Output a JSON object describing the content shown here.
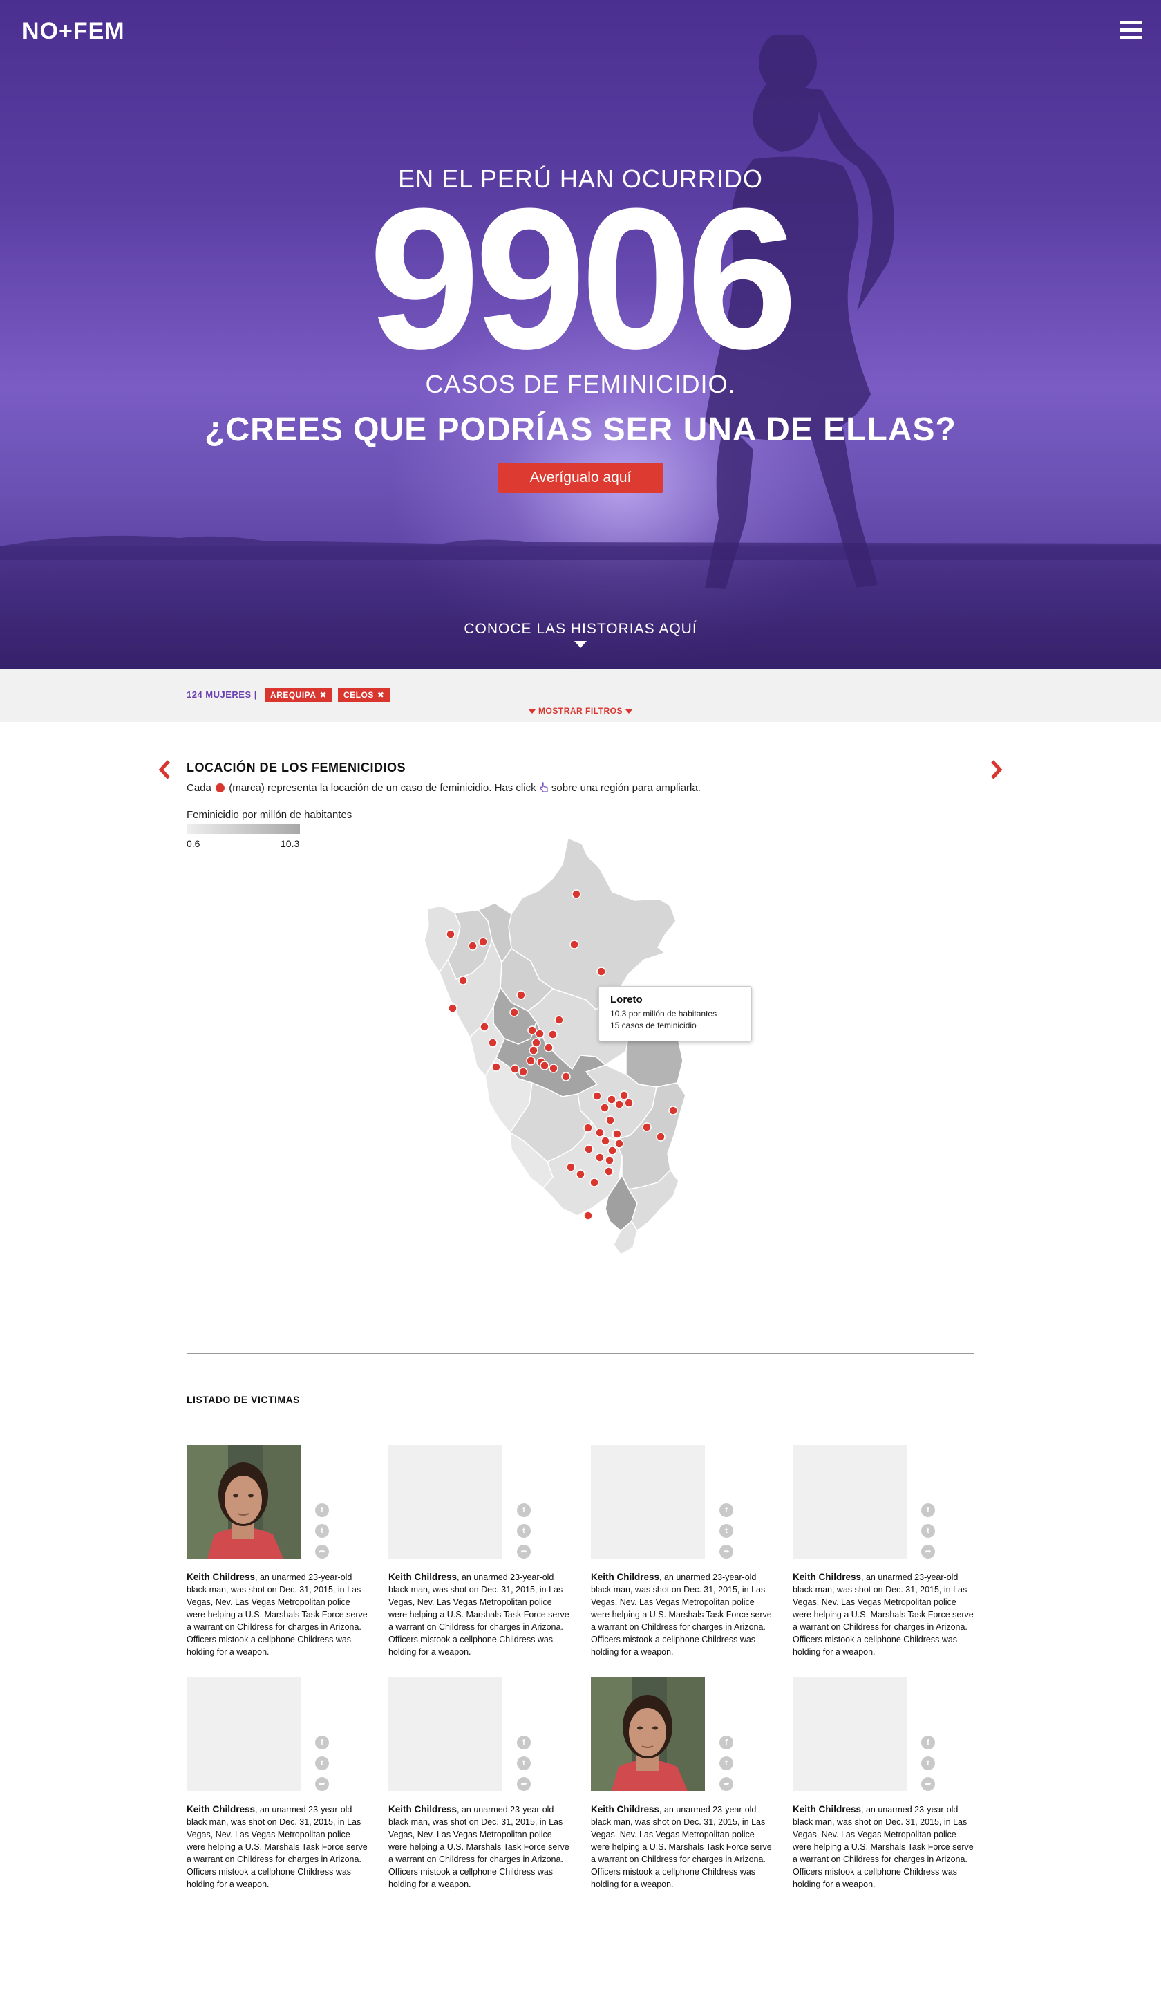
{
  "brand": {
    "logo": "NO+FEM"
  },
  "icons": {
    "menu": "hamburger-icon",
    "facebook": "facebook-icon",
    "twitter": "twitter-icon",
    "share": "share-icon"
  },
  "colors": {
    "accent": "#d9362f",
    "brand_purple": "#6a3fb0",
    "hero_purple": "#5b3ea2"
  },
  "hero": {
    "line1": "EN EL PERÚ HAN OCURRIDO",
    "number": "9906",
    "line2": "CASOS DE FEMINICIDIO.",
    "question": "¿CREES QUE PODRÍAS SER UNA DE ELLAS?",
    "cta": "Averígualo aquí",
    "stories": "CONOCE LAS HISTORIAS AQUÍ"
  },
  "filters": {
    "count": "124 MUJERES |",
    "tags": [
      "AREQUIPA",
      "CELOS"
    ],
    "show_filters": "MOSTRAR FILTROS"
  },
  "map": {
    "title": "LOCACIÓN DE LOS FEMENICIDIOS",
    "desc_before": "Cada",
    "desc_middle": "(marca) representa la locación de un caso de feminicidio. Has click",
    "desc_after": "sobre una región para ampliarla.",
    "legend_title": "Feminicidio por millón de habitantes",
    "legend_min": "0.6",
    "legend_max": "10.3",
    "tooltip": {
      "title": "Loreto",
      "line1": "10.3 por millón de habitantes",
      "line2": "15 casos de feminicidio"
    }
  },
  "victims": {
    "title": "LISTADO DE VICTIMAS",
    "cards": [
      {
        "name": "Keith Childress",
        "text": ", an unarmed 23-year-old black man, was shot on Dec. 31, 2015, in Las Vegas, Nev. Las Vegas Metropolitan police were helping a U.S. Marshals Task Force serve a warrant on Childress for charges in Arizona. Officers mistook a cellphone Childress was holding for a weapon.",
        "has_photo": true
      },
      {
        "name": "Keith Childress",
        "text": ", an unarmed 23-year-old black man, was shot on Dec. 31, 2015, in Las Vegas, Nev. Las Vegas Metropolitan police were helping a U.S. Marshals Task Force serve a warrant on Childress for charges in Arizona. Officers mistook a cellphone Childress was holding for a weapon.",
        "has_photo": false
      },
      {
        "name": "Keith Childress",
        "text": ", an unarmed 23-year-old black man, was shot on Dec. 31, 2015, in Las Vegas, Nev. Las Vegas Metropolitan police were helping a U.S. Marshals Task Force serve a warrant on Childress for charges in Arizona. Officers mistook a cellphone Childress was holding for a weapon.",
        "has_photo": false
      },
      {
        "name": "Keith Childress",
        "text": ", an unarmed 23-year-old black man, was shot on Dec. 31, 2015, in Las Vegas, Nev. Las Vegas Metropolitan police were helping a U.S. Marshals Task Force serve a warrant on Childress for charges in Arizona. Officers mistook a cellphone Childress was holding for a weapon.",
        "has_photo": false
      },
      {
        "name": "Keith Childress",
        "text": ", an unarmed 23-year-old black man, was shot on Dec. 31, 2015, in Las Vegas, Nev. Las Vegas Metropolitan police were helping a U.S. Marshals Task Force serve a warrant on Childress for charges in Arizona. Officers mistook a cellphone Childress was holding for a weapon.",
        "has_photo": false
      },
      {
        "name": "Keith Childress",
        "text": ", an unarmed 23-year-old black man, was shot on Dec. 31, 2015, in Las Vegas, Nev. Las Vegas Metropolitan police were helping a U.S. Marshals Task Force serve a warrant on Childress for charges in Arizona. Officers mistook a cellphone Childress was holding for a weapon.",
        "has_photo": false
      },
      {
        "name": "Keith Childress",
        "text": ", an unarmed 23-year-old black man, was shot on Dec. 31, 2015, in Las Vegas, Nev. Las Vegas Metropolitan police were helping a U.S. Marshals Task Force serve a warrant on Childress for charges in Arizona. Officers mistook a cellphone Childress was holding for a weapon.",
        "has_photo": true
      },
      {
        "name": "Keith Childress",
        "text": ", an unarmed 23-year-old black man, was shot on Dec. 31, 2015, in Las Vegas, Nev. Las Vegas Metropolitan police were helping a U.S. Marshals Task Force serve a warrant on Childress for charges in Arizona. Officers mistook a cellphone Childress was holding for a weapon.",
        "has_photo": false
      }
    ]
  }
}
